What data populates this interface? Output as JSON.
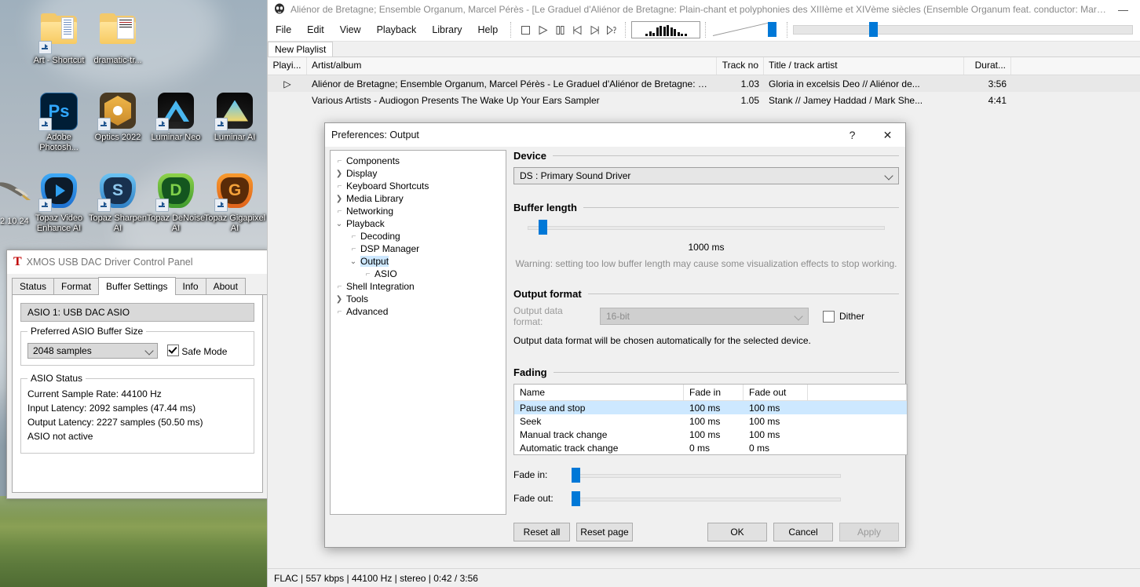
{
  "desktop": {
    "date_text": "2.10.24",
    "icons": [
      {
        "name": "Art - Shortcut",
        "type": "folder-shortcut"
      },
      {
        "name": "dramatic-tr...",
        "type": "folder"
      },
      {
        "name": "Adobe Photosh...",
        "type": "photoshop",
        "glyph": "Ps"
      },
      {
        "name": "Optics 2022",
        "type": "optics"
      },
      {
        "name": "Luminar Neo",
        "type": "luminar-neo"
      },
      {
        "name": "Luminar AI",
        "type": "luminar-ai"
      },
      {
        "name": "Topaz Video Enhance AI",
        "type": "topaz-video"
      },
      {
        "name": "Topaz Sharpen AI",
        "type": "topaz-sharpen",
        "glyph": "S"
      },
      {
        "name": "Topaz DeNoise AI",
        "type": "topaz-denoise",
        "glyph": "D"
      },
      {
        "name": "Topaz Gigapixel AI",
        "type": "topaz-gigapixel",
        "glyph": "G"
      }
    ]
  },
  "xmos": {
    "title": "XMOS USB DAC Driver Control Panel",
    "logo": "T",
    "tabs": [
      {
        "label": "Status",
        "active": false
      },
      {
        "label": "Format",
        "active": false
      },
      {
        "label": "Buffer Settings",
        "active": true
      },
      {
        "label": "Info",
        "active": false
      },
      {
        "label": "About",
        "active": false
      }
    ],
    "device_bar": "ASIO 1: USB DAC ASIO",
    "buffer_group": {
      "caption": "Preferred ASIO Buffer Size",
      "selected": "2048 samples",
      "safe_mode_label": "Safe Mode",
      "safe_mode_checked": true
    },
    "status_group": {
      "caption": "ASIO Status",
      "lines": [
        "Current Sample Rate: 44100 Hz",
        "Input Latency: 2092 samples (47.44 ms)",
        "Output Latency: 2227 samples (50.50 ms)",
        "ASIO not active"
      ]
    }
  },
  "foobar": {
    "title": "Aliénor de Bretagne; Ensemble Organum, Marcel Pérès - [Le Graduel d'Aliénor de Bretagne: Plain-chant et polyphonies des XIIIème et XIVème siècles (Ensemble Organum feat. conductor: Marcel Pérè...",
    "menu": [
      "File",
      "Edit",
      "View",
      "Playback",
      "Library",
      "Help"
    ],
    "transport": [
      "stop-icon",
      "play-icon",
      "pause-icon",
      "previous-icon",
      "next-icon",
      "random-icon"
    ],
    "playlist_tab": "New Playlist",
    "columns": [
      "Playi...",
      "Artist/album",
      "Track no",
      "Title / track artist",
      "Durat..."
    ],
    "rows": [
      {
        "playing": "▷",
        "artist": "Aliénor de Bretagne; Ensemble Organum, Marcel Pérès - Le Graduel d'Aliénor de Bretagne: Plai...",
        "track_no": "1.03",
        "title": "Gloria in excelsis Deo // Aliénor de...",
        "duration": "3:56",
        "selected": true
      },
      {
        "playing": "",
        "artist": "Various Artists - Audiogon Presents The Wake Up Your Ears Sampler",
        "track_no": "1.05",
        "title": "Stank // Jamey Haddad / Mark She...",
        "duration": "4:41",
        "selected": false
      }
    ],
    "status": "FLAC | 557 kbps | 44100 Hz | stereo | 0:42 / 3:56"
  },
  "prefs": {
    "title": "Preferences: Output",
    "help_label": "?",
    "close_label": "✕",
    "tree": [
      {
        "label": "Components",
        "indent": 0,
        "expander": "none",
        "selected": false
      },
      {
        "label": "Display",
        "indent": 0,
        "expander": "collapsed",
        "selected": false
      },
      {
        "label": "Keyboard Shortcuts",
        "indent": 0,
        "expander": "none",
        "selected": false
      },
      {
        "label": "Media Library",
        "indent": 0,
        "expander": "collapsed",
        "selected": false
      },
      {
        "label": "Networking",
        "indent": 0,
        "expander": "none",
        "selected": false
      },
      {
        "label": "Playback",
        "indent": 0,
        "expander": "expanded",
        "selected": false
      },
      {
        "label": "Decoding",
        "indent": 1,
        "expander": "none",
        "selected": false
      },
      {
        "label": "DSP Manager",
        "indent": 1,
        "expander": "none",
        "selected": false
      },
      {
        "label": "Output",
        "indent": 1,
        "expander": "expanded",
        "selected": true
      },
      {
        "label": "ASIO",
        "indent": 2,
        "expander": "none",
        "selected": false
      },
      {
        "label": "Shell Integration",
        "indent": 0,
        "expander": "none",
        "selected": false
      },
      {
        "label": "Tools",
        "indent": 0,
        "expander": "collapsed",
        "selected": false
      },
      {
        "label": "Advanced",
        "indent": 0,
        "expander": "none",
        "selected": false
      }
    ],
    "device": {
      "heading": "Device",
      "selected": "DS : Primary Sound Driver"
    },
    "buffer": {
      "heading": "Buffer length",
      "value_label": "1000 ms",
      "warning": "Warning: setting too low buffer length may cause some visualization effects to stop working."
    },
    "output_format": {
      "heading": "Output format",
      "label": "Output data format:",
      "selected": "16-bit",
      "dither_label": "Dither",
      "dither_checked": false,
      "note": "Output data format will be chosen automatically for the selected device."
    },
    "fading": {
      "heading": "Fading",
      "columns": [
        "Name",
        "Fade in",
        "Fade out"
      ],
      "rows": [
        {
          "name": "Pause and stop",
          "fade_in": "100 ms",
          "fade_out": "100 ms",
          "selected": true
        },
        {
          "name": "Seek",
          "fade_in": "100 ms",
          "fade_out": "100 ms",
          "selected": false
        },
        {
          "name": "Manual track change",
          "fade_in": "100 ms",
          "fade_out": "100 ms",
          "selected": false
        },
        {
          "name": "Automatic track change",
          "fade_in": "0 ms",
          "fade_out": "0 ms",
          "selected": false
        }
      ],
      "fade_in_label": "Fade in:",
      "fade_out_label": "Fade out:"
    },
    "buttons": {
      "reset_all": "Reset all",
      "reset_page": "Reset page",
      "ok": "OK",
      "cancel": "Cancel",
      "apply": "Apply"
    }
  },
  "colors": {
    "accent": "#0078d7",
    "selection": "#cde8ff",
    "window_bg": "#f0f0f0"
  }
}
